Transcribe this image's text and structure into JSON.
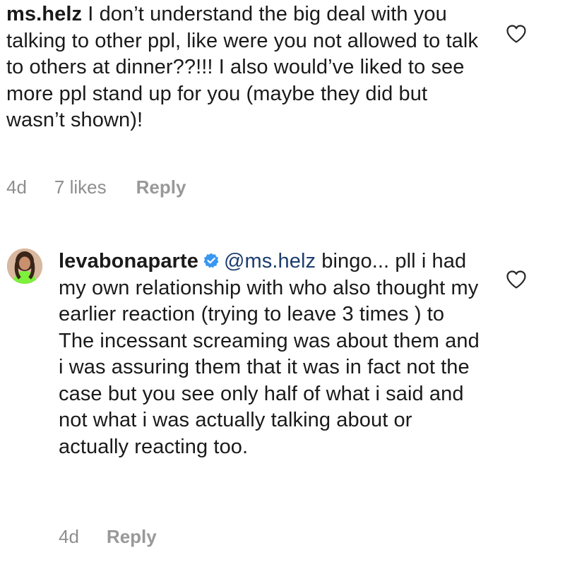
{
  "comments": [
    {
      "username": "ms.helz",
      "verified": false,
      "mention": "",
      "text": "I don’t understand the big deal with you talking to other ppl, like were you not allowed to talk to others at dinner??!!! I also would’ve liked to see more ppl stand up for you (maybe they did but wasn’t shown)!",
      "time": "4d",
      "likes": "7 likes",
      "reply_label": "Reply",
      "icon": "heart-outline-icon"
    },
    {
      "username": "levabonaparte",
      "verified": true,
      "mention": "@ms.helz",
      "text": "bingo... pll i had my own relationship with who also thought my earlier reaction (trying to leave 3 times ) to The incessant screaming  was about them and i was assuring them that it was in fact not the case but you see only half of what i said and not what i was actually talking about or actually reacting too.",
      "time": "4d",
      "likes": "",
      "reply_label": "Reply",
      "icon": "heart-outline-icon"
    }
  ],
  "colors": {
    "text": "#1a1a1a",
    "meta": "#8e8e8e",
    "mention": "#1c3d6e",
    "verified": "#3897f0"
  }
}
